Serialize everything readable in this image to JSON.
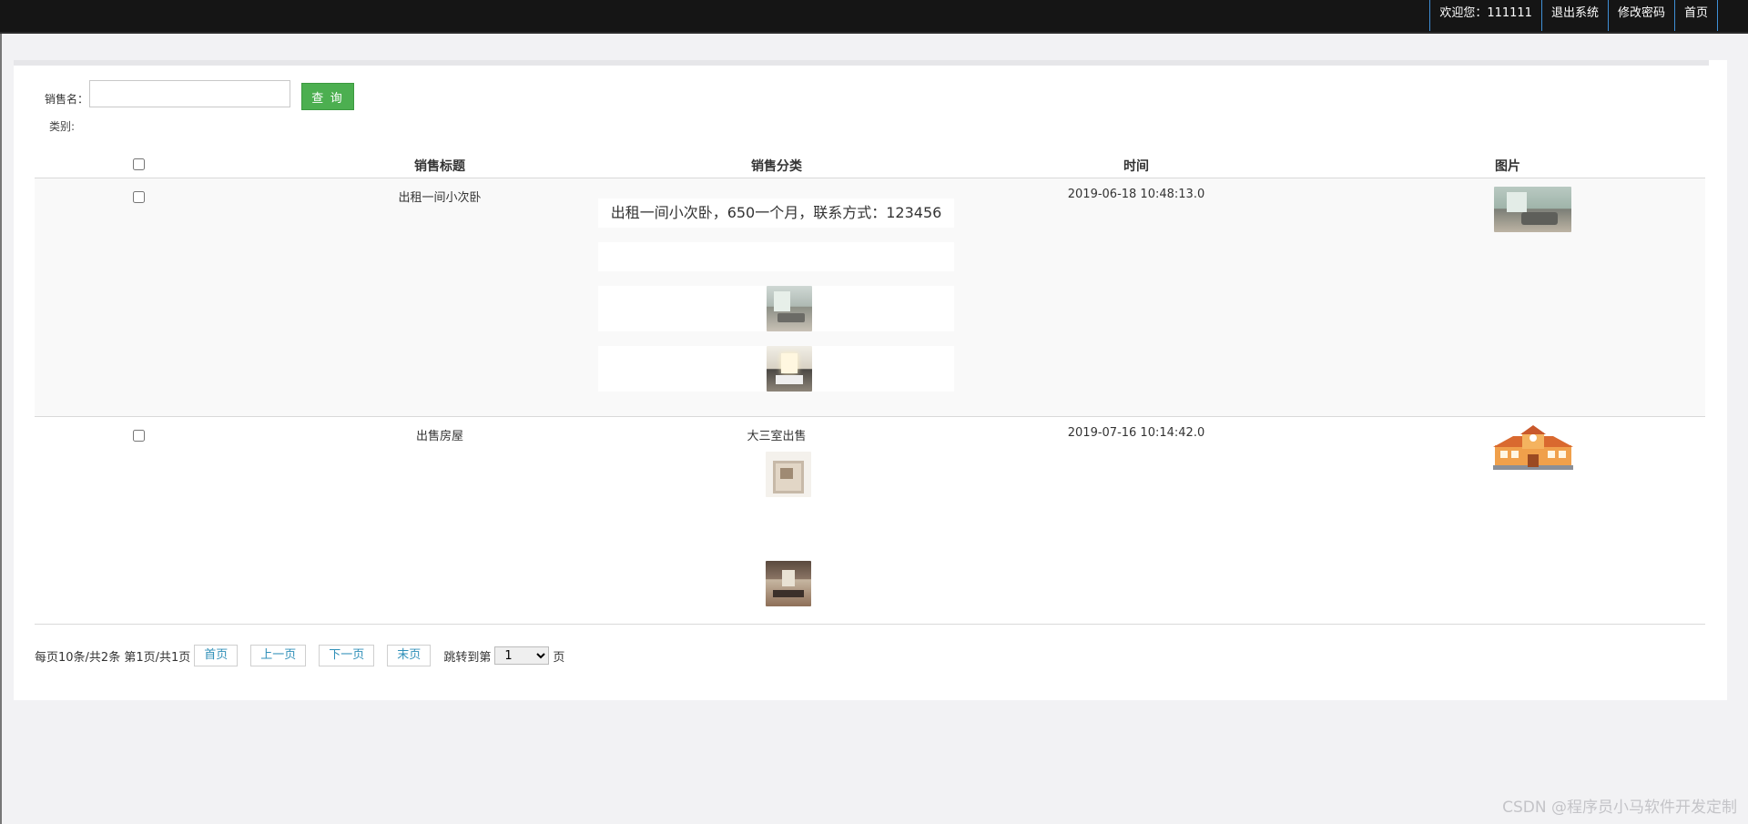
{
  "topbar": {
    "welcome": "欢迎您：111111",
    "logout": "退出系统",
    "change_password": "修改密码",
    "home": "首页"
  },
  "search": {
    "label": "销售名：",
    "value": "",
    "placeholder": "",
    "query_button": "查 询",
    "category_label": "类别:"
  },
  "table": {
    "columns": [
      "销售标题",
      "销售分类",
      "时间",
      "图片"
    ],
    "rows": [
      {
        "checked": false,
        "title": "出租一间小次卧",
        "description": "出租一间小次卧，650一个月，联系方式：123456",
        "description_images": [
          "room-photo",
          "bedroom-photo"
        ],
        "time": "2019-06-18 10:48:13.0",
        "image": "room-photo"
      },
      {
        "checked": false,
        "title": "出售房屋",
        "description": "大三室出售",
        "description_images": [
          "floorplan-photo",
          "living-room-photo"
        ],
        "time": "2019-07-16 10:14:42.0",
        "image": "school-building-illustration"
      }
    ]
  },
  "pagination": {
    "summary": "每页10条/共2条 第1页/共1页",
    "first": "首页",
    "prev": "上一页",
    "next": "下一页",
    "last": "末页",
    "jump_label": "跳转到第",
    "jump_value": "1",
    "page_suffix": "页"
  },
  "watermark": "CSDN @程序员小马软件开发定制",
  "colors": {
    "topbar_bg": "#151515",
    "nav_divider": "#3f8fd6",
    "query_button": "#4caf50",
    "pager_link": "#2f8fb8"
  }
}
